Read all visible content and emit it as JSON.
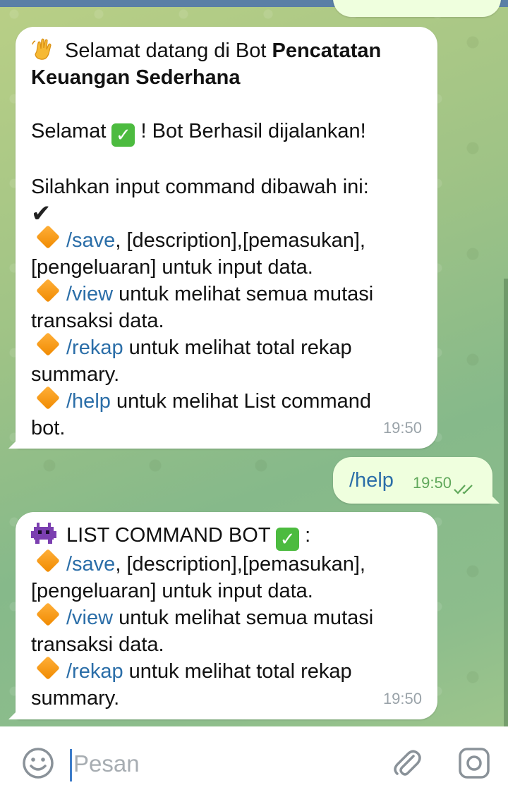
{
  "messages": [
    {
      "id": "welcome",
      "direction": "incoming",
      "line1_text": " Selamat datang di Bot ",
      "line1_bold": "Pencatatan",
      "line2_bold": "Keuangan Sederhana",
      "success_prefix": "Selamat ",
      "success_suffix": " ! Bot Berhasil dijalankan!",
      "instruction": "Silahkan input command dibawah ini:",
      "commands": [
        {
          "cmd": "/save",
          "desc": ", [description],[pemasukan],",
          "cont": "[pengeluaran] untuk input data."
        },
        {
          "cmd": "/view",
          "desc": " untuk melihat semua mutasi",
          "cont": "transaksi data."
        },
        {
          "cmd": "/rekap",
          "desc": " untuk melihat total rekap",
          "cont": "summary."
        },
        {
          "cmd": "/help",
          "desc": " untuk melihat List command",
          "cont": "bot."
        }
      ],
      "time": "19:50"
    },
    {
      "id": "user-help",
      "direction": "outgoing",
      "text": "/help",
      "time": "19:50",
      "status": "read"
    },
    {
      "id": "list-command",
      "direction": "incoming",
      "header": " LIST COMMAND BOT ",
      "header_suffix": " :",
      "commands": [
        {
          "cmd": "/save",
          "desc": ", [description],[pemasukan],",
          "cont": "[pengeluaran] untuk input data."
        },
        {
          "cmd": "/view",
          "desc": " untuk melihat semua mutasi",
          "cont": "transaksi data."
        },
        {
          "cmd": "/rekap",
          "desc": " untuk melihat total rekap",
          "cont": "summary."
        }
      ],
      "time": "19:50"
    }
  ],
  "composer": {
    "placeholder": "Pesan",
    "icons": [
      "emoji-icon",
      "attach-icon",
      "camera-icon"
    ]
  },
  "colors": {
    "link": "#2b6ea8",
    "outgoing_bubble": "#efffde",
    "incoming_bubble": "#ffffff",
    "check_emoji": "#4cbb3f"
  },
  "icon_names": [
    "waving-hand-icon",
    "check-mark-emoji-icon",
    "heavy-check-icon",
    "orange-diamond-icon",
    "alien-monster-icon",
    "double-tick-icon"
  ]
}
